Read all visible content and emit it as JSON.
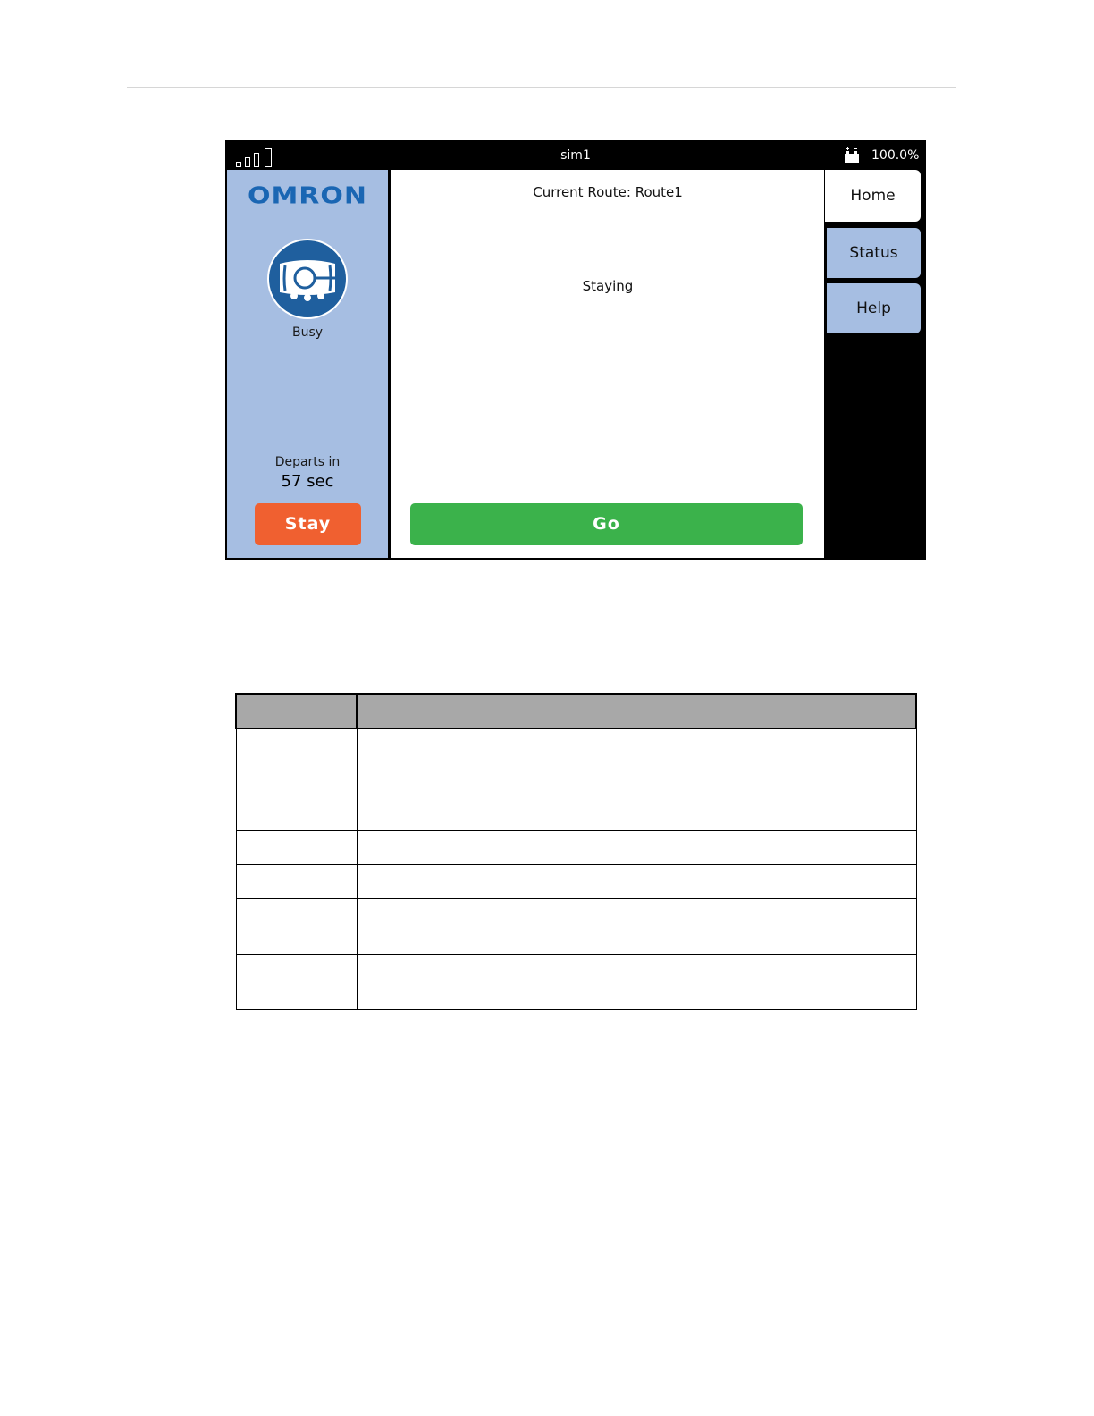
{
  "statusbar": {
    "device_name": "sim1",
    "battery_level": "100.0%",
    "signal_icon": "signal-bars-icon",
    "battery_icon": "battery-charging-icon"
  },
  "left_panel": {
    "logo_text": "OMRON",
    "robot_icon": "robot-icon",
    "robot_status": "Busy",
    "departs_label": "Departs in",
    "departs_value": "57 sec",
    "stay_label": "Stay"
  },
  "main_panel": {
    "current_route": "Current Route: Route1",
    "state": "Staying",
    "go_label": "Go"
  },
  "nav": {
    "home": "Home",
    "status": "Status",
    "help": "Help"
  },
  "colors": {
    "panel_blue": "#a6bee2",
    "logo_blue": "#1a66b3",
    "stay_orange": "#f06030",
    "go_green": "#3bb24b",
    "table_header_gray": "#a8a8a8"
  }
}
